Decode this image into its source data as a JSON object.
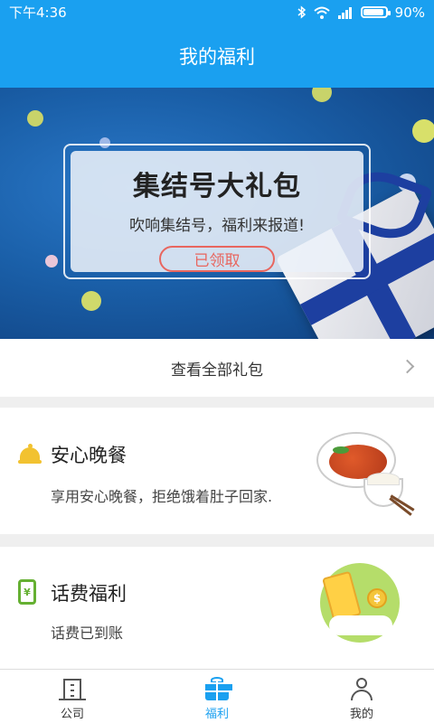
{
  "status_bar": {
    "time": "下午4:36",
    "battery_pct": "90%",
    "icons": [
      "bluetooth-icon",
      "wifi-icon",
      "signal-icon",
      "battery-icon"
    ]
  },
  "header": {
    "title": "我的福利"
  },
  "banner": {
    "title": "集结号大礼包",
    "subtitle": "吹响集结号，福利来报道!",
    "button_label": "已领取"
  },
  "view_all": {
    "label": "查看全部礼包"
  },
  "sections": [
    {
      "icon": "dinner-cloche-icon",
      "title": "安心晚餐",
      "description": "享用安心晚餐，拒绝饿着肚子回家."
    },
    {
      "icon": "phone-yuan-icon",
      "title": "话费福利",
      "description": "话费已到账"
    }
  ],
  "tabs": [
    {
      "icon": "building-icon",
      "label": "公司",
      "active": false
    },
    {
      "icon": "gift-icon",
      "label": "福利",
      "active": true
    },
    {
      "icon": "user-icon",
      "label": "我的",
      "active": false
    }
  ],
  "colors": {
    "primary": "#1aa0f0",
    "claimed_button": "#e8665f",
    "dinner_icon": "#f2c230",
    "phone_icon": "#65b032"
  }
}
